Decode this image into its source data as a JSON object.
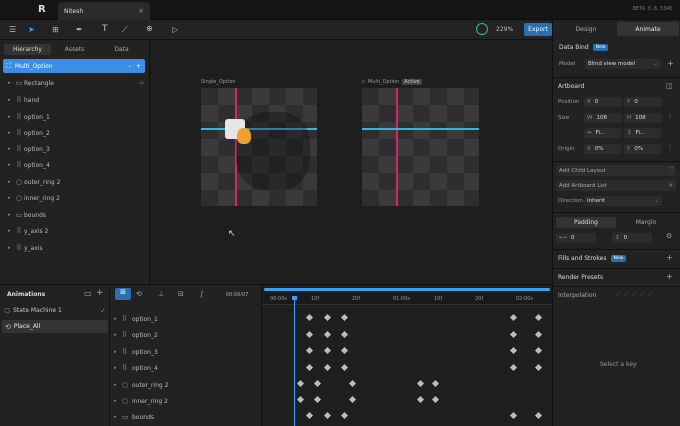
{
  "app": {
    "file_name": "Nitesh",
    "version": "BETA 0.8.5348",
    "zoom": "229%",
    "export_label": "Export",
    "mode_design": "Design",
    "mode_animate": "Animate"
  },
  "left": {
    "tabs": [
      "Hierarchy",
      "Assets",
      "Data"
    ],
    "selected": "Multi_Option",
    "items": [
      "Rectangle",
      "hand",
      "option_1",
      "option_2",
      "option_3",
      "option_4",
      "outer_ring 2",
      "inner_ring 2",
      "bounds",
      "y_axis 2",
      "y_axis"
    ]
  },
  "canvas": {
    "artboard1": "Single_Option",
    "artboard2": "Multi_Option",
    "active_badge": "Active"
  },
  "right": {
    "data_bind": "Data Bind",
    "new_badge": "New",
    "model_label": "Model",
    "model_value": "Blind view model",
    "artboard": "Artboard",
    "position": "Position",
    "pos_x_label": "X",
    "pos_x": "0",
    "pos_y_label": "Y",
    "pos_y": "0",
    "size": "Size",
    "w_label": "W",
    "w": "108",
    "h_label": "H",
    "h": "108",
    "fit1": "Fi...",
    "fit2": "Fi...",
    "origin": "Origin",
    "ox_label": "X",
    "ox": "0%",
    "oy_label": "Y",
    "oy": "0%",
    "add_child": "Add Child Layout",
    "add_list": "Add Artboard List",
    "direction_label": "Direction",
    "direction": "Inherit",
    "padding": "Padding",
    "margin": "Margin",
    "pad1": "0",
    "pad2": "0",
    "fills": "Fills and Strokes",
    "render": "Render Presets",
    "interpolation": "Interpolation",
    "select_key": "Select a key"
  },
  "anim": {
    "header": "Animations",
    "state_machine": "State Machine 1",
    "selected_anim": "Place_All",
    "time": "00:00/07",
    "ruler": [
      "00:00s",
      "10f",
      "20f",
      "01:00s",
      "10f",
      "20f",
      "02:00s"
    ],
    "rows": [
      "option_1",
      "option_2",
      "option_3",
      "option_4",
      "outer_ring 2",
      "inner_ring 2",
      "bounds"
    ]
  },
  "colors": {
    "accent": "#3aa0ff",
    "selected": "#2f7fd6",
    "export": "#2a6fb0",
    "pink": "#d6246e",
    "cyan": "#33b4e8"
  }
}
